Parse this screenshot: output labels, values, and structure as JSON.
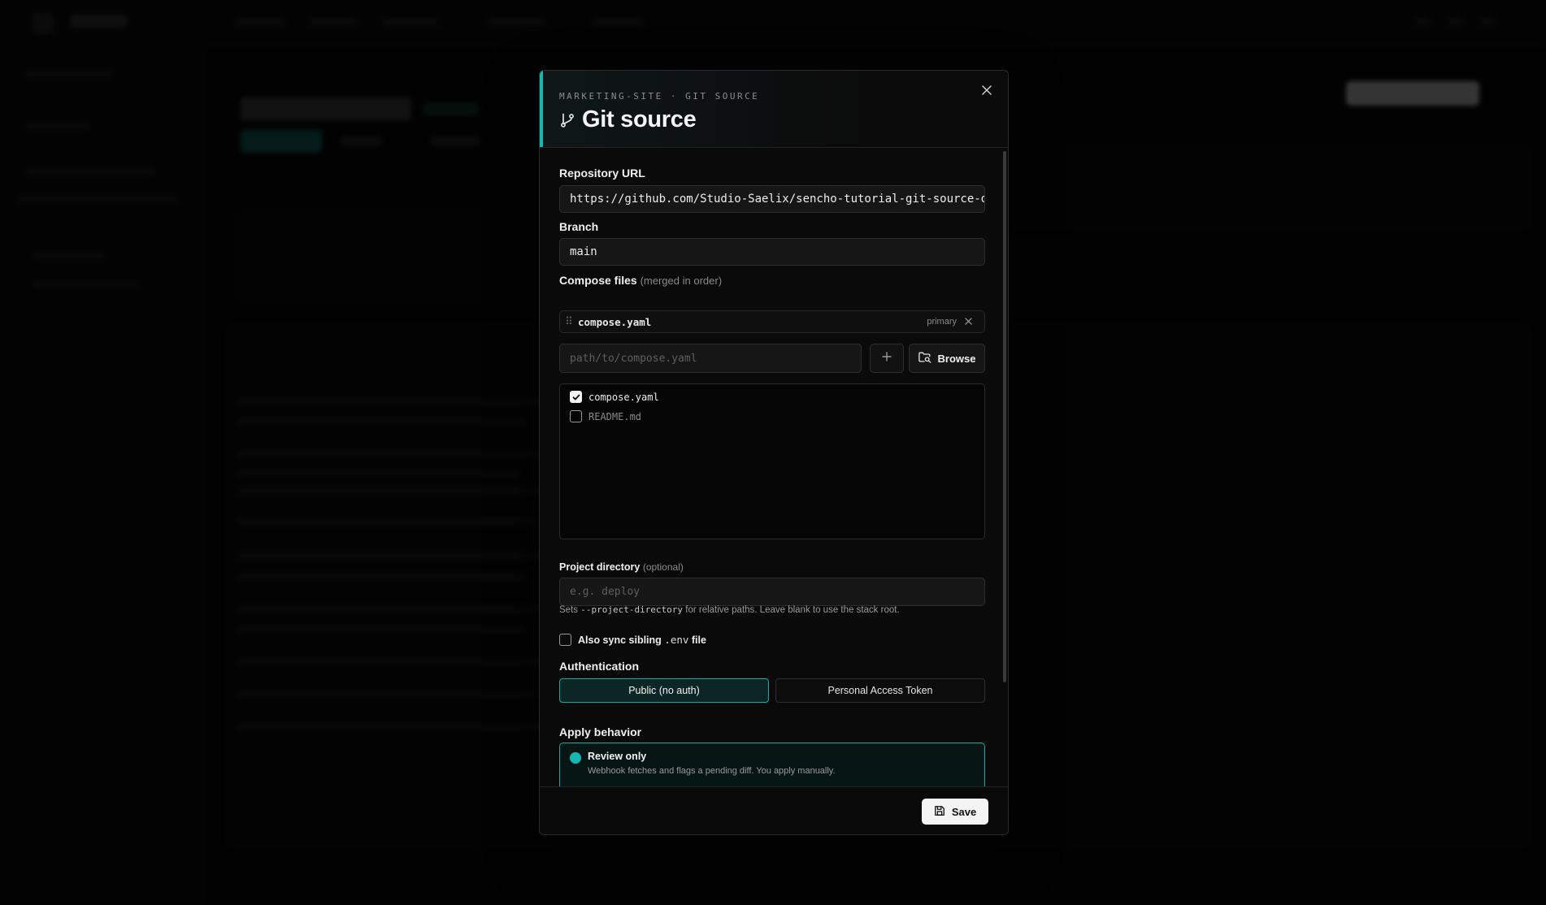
{
  "modal": {
    "eyebrow": "MARKETING-SITE · GIT SOURCE",
    "title": "Git source",
    "title_icon": "git-branch-icon",
    "close_icon": "close-icon"
  },
  "repository": {
    "label": "Repository URL",
    "value": "https://github.com/Studio-Saelix/sencho-tutorial-git-source-demo"
  },
  "branch": {
    "label": "Branch",
    "value": "main"
  },
  "compose_files": {
    "label": "Compose files",
    "label_suffix": "(merged in order)",
    "chips": [
      {
        "name": "compose.yaml",
        "tag": "primary"
      }
    ],
    "path_placeholder": "path/to/compose.yaml",
    "browse_label": "Browse",
    "list": [
      {
        "name": "compose.yaml",
        "checked": true
      },
      {
        "name": "README.md",
        "checked": false
      }
    ]
  },
  "project_directory": {
    "label": "Project directory",
    "label_suffix": "(optional)",
    "placeholder": "e.g. deploy",
    "hint_prefix": "Sets",
    "hint_code": "--project-directory",
    "hint_suffix": "for relative paths. Leave blank to use the stack root."
  },
  "sync_env": {
    "label_prefix": "Also sync sibling",
    "label_code": ".env",
    "label_suffix": "file",
    "checked": false
  },
  "authentication": {
    "label": "Authentication",
    "options": [
      "Public (no auth)",
      "Personal Access Token"
    ],
    "selected": "Public (no auth)"
  },
  "apply_behavior": {
    "label": "Apply behavior",
    "selected_title": "Review only",
    "selected_desc": "Webhook fetches and flags a pending diff. You apply manually."
  },
  "footer": {
    "save_label": "Save"
  },
  "colors": {
    "accent": "#14b8b1",
    "background": "#060606",
    "modal": "#0a0a0a"
  }
}
